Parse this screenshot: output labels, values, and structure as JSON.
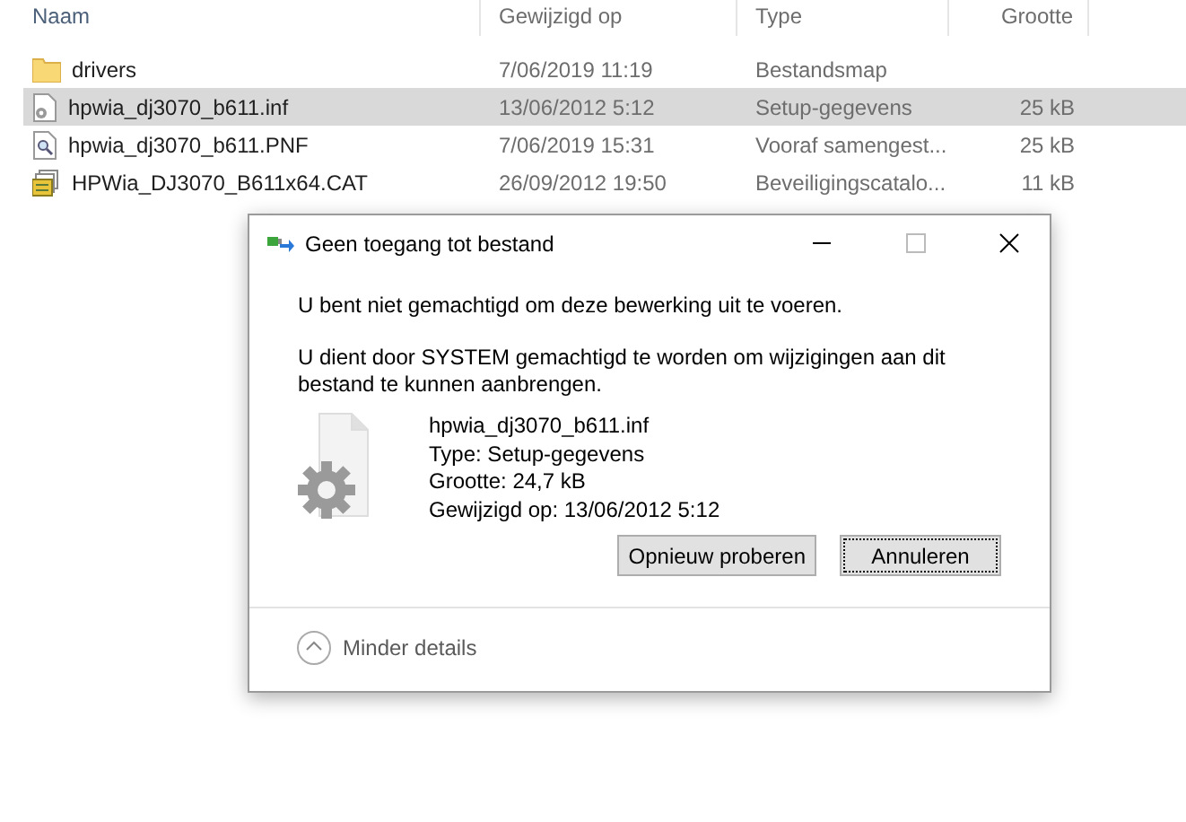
{
  "explorer": {
    "columns": [
      "Naam",
      "Gewijzigd op",
      "Type",
      "Grootte"
    ],
    "rows": [
      {
        "kind": "folder",
        "name": "drivers",
        "modified": "7/06/2019 11:19",
        "type": "Bestandsmap",
        "size": "",
        "selected": false
      },
      {
        "kind": "setup",
        "name": "hpwia_dj3070_b611.inf",
        "modified": "13/06/2012 5:12",
        "type": "Setup-gegevens",
        "size": "25 kB",
        "selected": true
      },
      {
        "kind": "pnf",
        "name": "hpwia_dj3070_b611.PNF",
        "modified": "7/06/2019 15:31",
        "type": "Vooraf samengest...",
        "size": "25 kB",
        "selected": false
      },
      {
        "kind": "catalog",
        "name": "HPWia_DJ3070_B611x64.CAT",
        "modified": "26/09/2012 19:50",
        "type": "Beveiligingscatalo...",
        "size": "11 kB",
        "selected": false
      }
    ]
  },
  "dialog": {
    "title": "Geen toegang tot bestand",
    "message": "U bent niet gemachtigd om deze bewerking uit te voeren.",
    "detail": "U dient door SYSTEM gemachtigd te worden om wijzigingen aan dit bestand te kunnen aanbrengen.",
    "file": {
      "name": "hpwia_dj3070_b611.inf",
      "type": "Type: Setup-gegevens",
      "size": "Grootte: 24,7 kB",
      "modified": "Gewijzigd op: 13/06/2012 5:12"
    },
    "buttons": [
      {
        "label": "Opnieuw proberen",
        "focused": false
      },
      {
        "label": "Annuleren",
        "focused": true
      }
    ],
    "details_toggle": {
      "label": "Minder details",
      "expanded": true
    }
  }
}
